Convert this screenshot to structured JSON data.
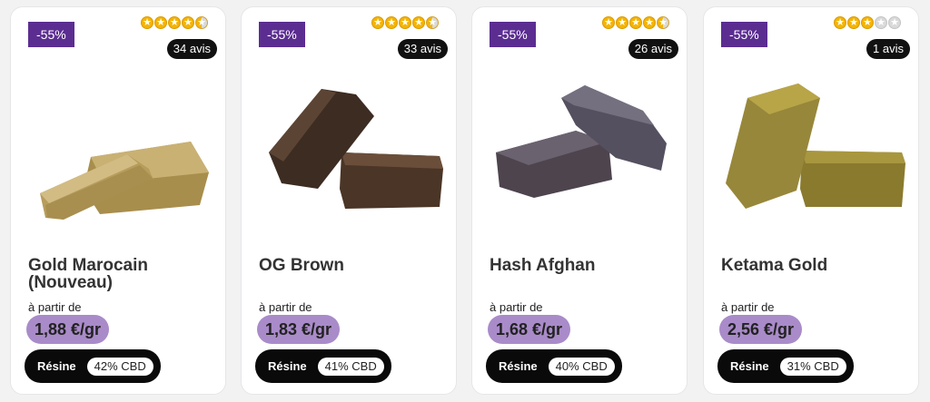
{
  "products": [
    {
      "discount": "-55%",
      "rating": 4.5,
      "star_icons": [
        "star-full-icon",
        "star-full-icon",
        "star-full-icon",
        "star-full-icon",
        "star-half-icon"
      ],
      "reviews": "34 avis",
      "name": "Gold Marocain (Nouveau)",
      "from_label": "à partir de",
      "price": "1,88 €/gr",
      "category": "Résine",
      "cbd": "42% CBD"
    },
    {
      "discount": "-55%",
      "rating": 4.5,
      "star_icons": [
        "star-full-icon",
        "star-full-icon",
        "star-full-icon",
        "star-full-icon",
        "star-half-icon"
      ],
      "reviews": "33 avis",
      "name": "OG Brown",
      "from_label": "à partir de",
      "price": "1,83 €/gr",
      "category": "Résine",
      "cbd": "41% CBD"
    },
    {
      "discount": "-55%",
      "rating": 4.5,
      "star_icons": [
        "star-full-icon",
        "star-full-icon",
        "star-full-icon",
        "star-full-icon",
        "star-half-icon"
      ],
      "reviews": "26 avis",
      "name": "Hash Afghan",
      "from_label": "à partir de",
      "price": "1,68 €/gr",
      "category": "Résine",
      "cbd": "40% CBD"
    },
    {
      "discount": "-55%",
      "rating": 3,
      "star_icons": [
        "star-full-icon",
        "star-full-icon",
        "star-full-icon",
        "star-empty-icon",
        "star-empty-icon"
      ],
      "reviews": "1 avis",
      "name": "Ketama Gold",
      "from_label": "à partir de",
      "price": "2,56 €/gr",
      "category": "Résine",
      "cbd": "31% CBD"
    }
  ],
  "colors": {
    "discount_bg": "#5b2d91",
    "price_bg": "#a98bc9",
    "tag_bg": "#0a0a0a",
    "star": "#f5b400",
    "gold_marocain": "#b9a15c",
    "og_brown": "#4a3526",
    "hash_afghan": "#4d444e",
    "ketama_gold": "#8a7a2e"
  }
}
